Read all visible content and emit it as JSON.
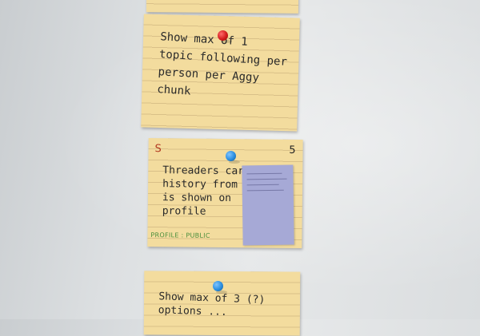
{
  "scene": "story-cards-on-wall",
  "colors": {
    "wall": "#dfe2e3",
    "card": "#f3dc9e",
    "sticky_note": "#a6a9d6",
    "pin_red": "#d21c1c",
    "pin_blue": "#2a8ee0",
    "corner_mark": "#b23a22",
    "tag": "#4b8e3c"
  },
  "cards": [
    {
      "lines": [
        "Show max of 1",
        "topic following per",
        "person per Aggy chunk"
      ]
    },
    {
      "corner_left": "S",
      "corner_right": "5",
      "lines": [
        "Threaders career",
        "history from U",
        "is shown on",
        "profile"
      ],
      "tag": "PROFILE : PUBLIC"
    },
    {
      "lines": [
        "Show max of 3 (?)",
        "options ..."
      ]
    }
  ]
}
